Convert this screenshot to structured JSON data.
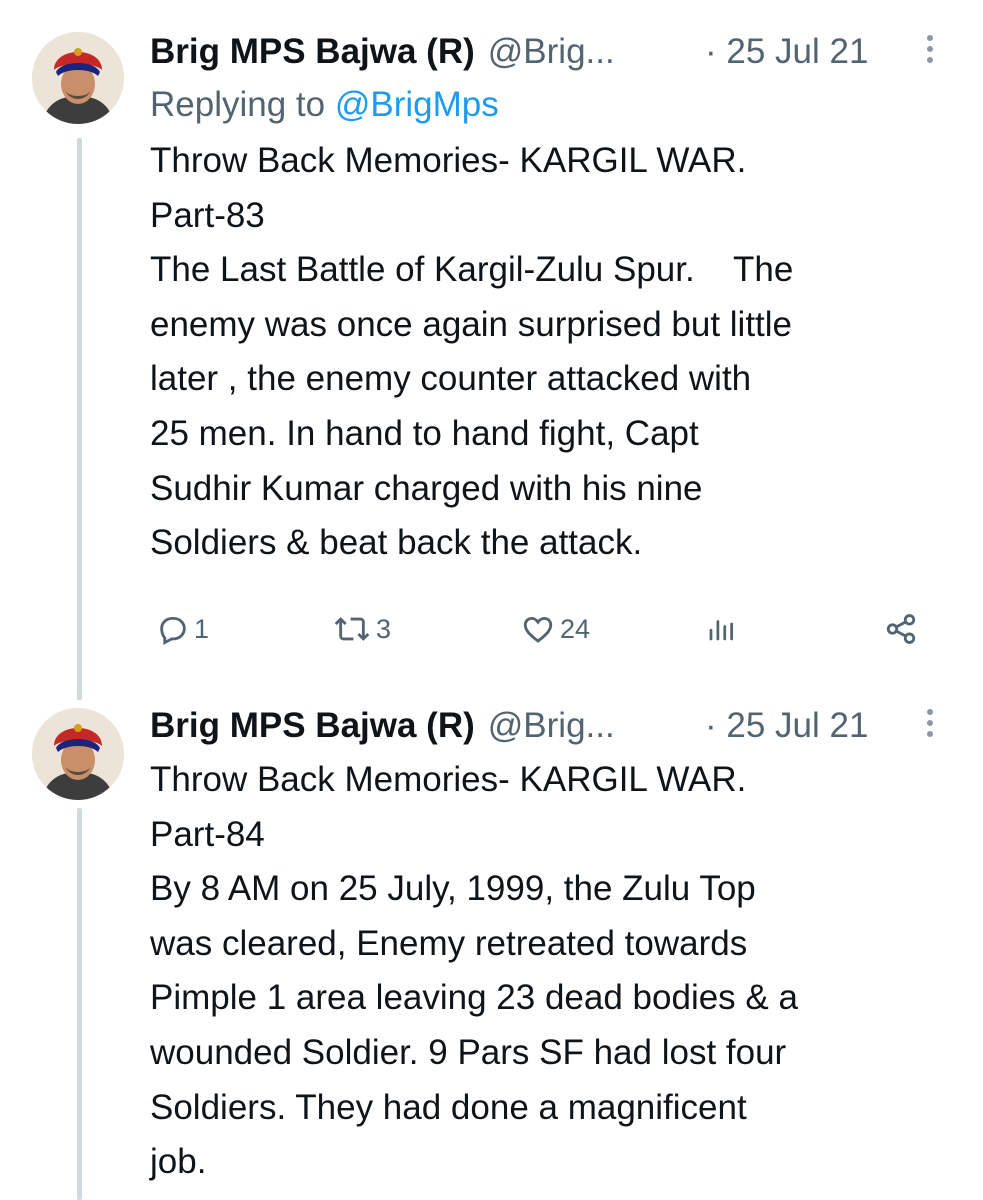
{
  "tweets": [
    {
      "author_name": "Brig MPS Bajwa (R)",
      "handle": "@Brig...",
      "date": "· 25 Jul 21",
      "replying_prefix": "Replying to ",
      "replying_to": "@BrigMps",
      "lines": [
        "Throw Back Memories- KARGIL WAR.",
        "Part-83",
        "The Last Battle of Kargil-Zulu Spur.    The",
        "enemy was once again surprised but little",
        "later , the enemy counter attacked with",
        "25 men. In hand to hand fight, Capt",
        "Sudhir Kumar charged with his nine",
        "Soldiers & beat back the attack."
      ],
      "actions": {
        "replies": "1",
        "retweets": "3",
        "likes": "24"
      }
    },
    {
      "author_name": "Brig MPS Bajwa (R)",
      "handle": "@Brig...",
      "date": "· 25 Jul 21",
      "lines": [
        "Throw Back Memories- KARGIL WAR.",
        "Part-84",
        "By 8 AM on 25 July, 1999, the Zulu Top",
        "was cleared, Enemy retreated towards",
        "Pimple 1 area leaving 23 dead bodies & a",
        "wounded Soldier. 9 Pars SF had lost four",
        "Soldiers. They had done a magnificent",
        "job."
      ]
    }
  ],
  "icons": {
    "reply": "reply-icon",
    "retweet": "retweet-icon",
    "like": "heart-icon",
    "views": "views-icon",
    "share": "share-icon",
    "more": "more-vertical-icon"
  },
  "colors": {
    "text": "#0f1419",
    "secondary": "#536471",
    "link": "#1d9bf0",
    "thread_line": "#cfd9de"
  }
}
